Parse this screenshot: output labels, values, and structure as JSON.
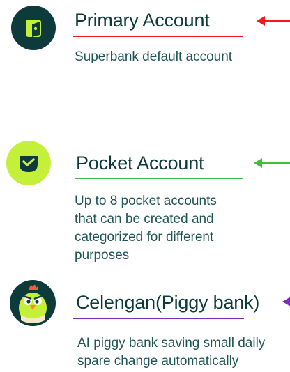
{
  "colors": {
    "primary_arrow": "#ee1c1c",
    "pocket_arrow": "#3fbf3a",
    "celengan_arrow": "#7a2fb8",
    "lime": "#c4f03a",
    "dark": "#0d3a3b"
  },
  "sections": [
    {
      "icon": "wallet-icon",
      "title": "Primary Account",
      "description": "Superbank default account"
    },
    {
      "icon": "pocket-check-icon",
      "title": "Pocket Account",
      "description": "Up to 8 pocket accounts that can be created and categorized for different purposes"
    },
    {
      "icon": "piggy-mascot-icon",
      "title": "Celengan(Piggy bank)",
      "description": "AI piggy bank saving small daily spare change automatically"
    }
  ]
}
